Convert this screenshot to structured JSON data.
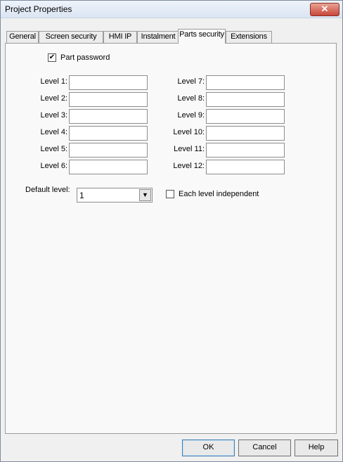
{
  "window": {
    "title": "Project Properties",
    "close_glyph": "✕"
  },
  "tabs": [
    {
      "label": "General"
    },
    {
      "label": "Screen security"
    },
    {
      "label": "HMI IP"
    },
    {
      "label": "Instalment"
    },
    {
      "label": "Parts security",
      "active": true
    },
    {
      "label": "Extensions"
    }
  ],
  "parts_password": {
    "label": "Part password",
    "checked": true
  },
  "levels_left": [
    {
      "label": "Level 1:",
      "value": ""
    },
    {
      "label": "Level 2:",
      "value": ""
    },
    {
      "label": "Level 3:",
      "value": ""
    },
    {
      "label": "Level 4:",
      "value": ""
    },
    {
      "label": "Level 5:",
      "value": ""
    },
    {
      "label": "Level 6:",
      "value": ""
    }
  ],
  "levels_right": [
    {
      "label": "Level 7:",
      "value": ""
    },
    {
      "label": "Level 8:",
      "value": ""
    },
    {
      "label": "Level 9:",
      "value": ""
    },
    {
      "label": "Level 10:",
      "value": ""
    },
    {
      "label": "Level 11:",
      "value": ""
    },
    {
      "label": "Level 12:",
      "value": ""
    }
  ],
  "default_level": {
    "label": "Default level:",
    "value": "1",
    "arrow": "▼"
  },
  "each_level_independent": {
    "label": "Each level independent",
    "checked": false
  },
  "buttons": {
    "ok": "OK",
    "cancel": "Cancel",
    "help": "Help"
  },
  "check_glyph": "✔"
}
